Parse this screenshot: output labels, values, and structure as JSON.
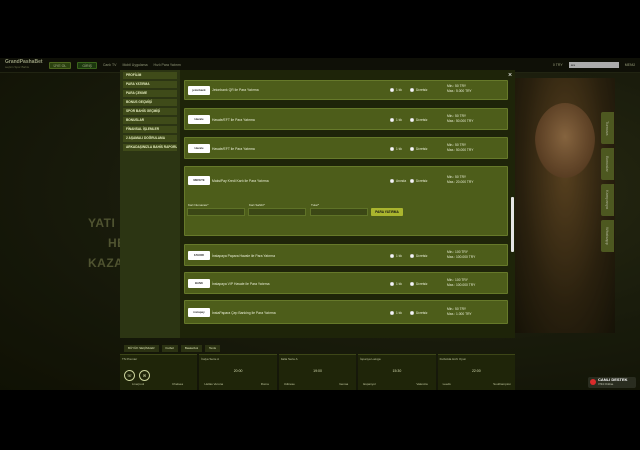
{
  "header": {
    "logo": "GrandPashaBet",
    "logo_sub": "seçkin Spor Bahis",
    "btn_register": "ÜYE OL",
    "btn_login": "GİRİŞ",
    "nav": [
      "Canlı TV",
      "Mobil Uygulama",
      "Hızlı Para Yatırım"
    ],
    "search_placeholder": "ara",
    "balance": "0 TRY",
    "user": "MENÜ"
  },
  "sidebar": {
    "items": [
      "PROFİLİM",
      "PARA YATIRMA",
      "PARA ÇEKME",
      "BONUS GEÇMİŞİ",
      "SPOR BAHİS GEÇMİŞİ",
      "BONUSLAR",
      "FİNANSAL İŞLEMLER",
      "2 AŞAMALI DOĞRULAMA",
      "ARKADAŞINIZLA BAHİS RAPORU"
    ]
  },
  "modal": {
    "close": "×",
    "rows": [
      {
        "logo": "jetonbank",
        "name": "Jetonbank QR ile Para Yatırma",
        "opt1": "1 tık",
        "opt2": "Ücretsiz",
        "min": "Min.: 50 TRY",
        "max": "Max.: 5.000 TRY"
      },
      {
        "logo": "Havale",
        "name": "Havale/EFT ile Para Yatırma",
        "opt1": "1 tık",
        "opt2": "Ücretsiz",
        "min": "Min.: 50 TRY",
        "max": "Max.: 50.000 TRY"
      },
      {
        "logo": "Havale",
        "name": "Havale/EFT ile Para Yatırma",
        "opt1": "1 tık",
        "opt2": "Ücretsiz",
        "min": "Min.: 50 TRY",
        "max": "Max.: 50.000 TRY"
      },
      {
        "logo": "MEFETE",
        "name": "MaksiPay Kredi Kartı ile Para Yatırma",
        "opt1": "Anında",
        "opt2": "Ücretsiz",
        "min": "Min.: 50 TRY",
        "max": "Max.: 20.000 TRY"
      },
      {
        "logo": "FAVORI",
        "name": "İnstapaya Papara Havale ile Para Yatırma",
        "opt1": "1 tık",
        "opt2": "Ücretsiz",
        "min": "Min.: 100 TRY",
        "max": "Max.: 100.000 TRY"
      },
      {
        "logo": "BANK",
        "name": "İnstapaya VIP Havale ile Para Yatırma",
        "opt1": "1 tık",
        "opt2": "Ücretsiz",
        "min": "Min.: 100 TRY",
        "max": "Max.: 100.000 TRY"
      },
      {
        "logo": "instapay",
        "name": "İnstaPapara Çep Banking ile Para Yatırma",
        "opt1": "1 tık",
        "opt2": "Ücretsiz",
        "min": "Min.: 50 TRY",
        "max": "Max.: 1.000 TRY"
      }
    ],
    "form": {
      "label1": "Kart Numarası*",
      "label2": "Kart Sahibi*",
      "label3": "Tutar*",
      "submit": "PARA YATIRMA"
    }
  },
  "hero": {
    "line1": "YATI",
    "line2": "HE",
    "line3": "KAZA"
  },
  "side_tabs": [
    "Turnuva",
    "Bonuslar",
    "Kampanya",
    "Whatsapp"
  ],
  "sports": {
    "tabs": [
      "BÜYÜK SEÇİMLER",
      "Futbol",
      "Basketbol",
      "Tenis"
    ],
    "matches": [
      {
        "league": "TS Premier",
        "time": "",
        "t1": "Liverpool",
        "t2": "Chelsea"
      },
      {
        "league": "İtalya Serie A",
        "time": "20:00",
        "t1": "Hellas Verona",
        "t2": "Roma"
      },
      {
        "league": "Italia Serie A",
        "time": "19:00",
        "t1": "Udinese",
        "t2": "Genoa"
      },
      {
        "league": "İspanya LaLiga",
        "time": "15:30",
        "t1": "Espanyol",
        "t2": "Valencia"
      },
      {
        "league": "Futbolda Hızlı Oyun",
        "time": "22:00",
        "t1": "Leeds",
        "t2": "Southampton"
      }
    ]
  },
  "support": {
    "title": "CANLI DESTEK",
    "sub": "7/24 Online"
  }
}
